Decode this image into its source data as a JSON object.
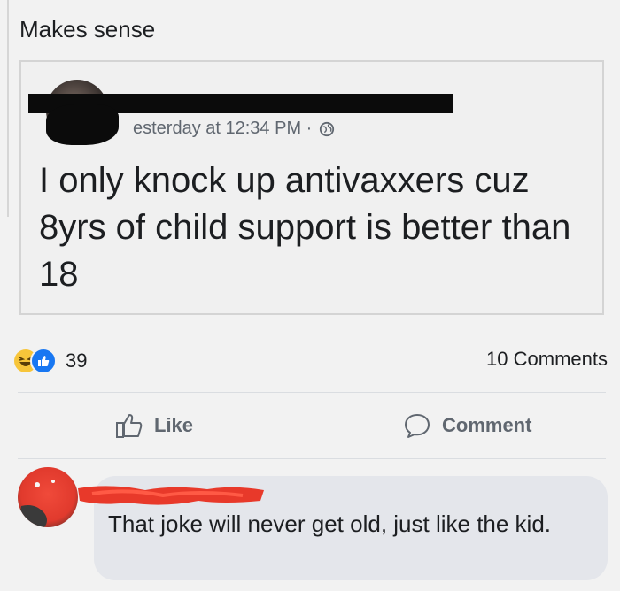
{
  "post": {
    "caption": "Makes sense"
  },
  "shared_post": {
    "timestamp": "esterday at 12:34 PM ·",
    "privacy_icon": "globe-icon",
    "text": "I only knock up antivaxxers cuz 8yrs of child support is better than 18"
  },
  "stats": {
    "reaction_icons": [
      "haha-icon",
      "like-icon"
    ],
    "reaction_count": "39",
    "comments_label": "10 Comments"
  },
  "actions": {
    "like_label": "Like",
    "comment_label": "Comment"
  },
  "comment": {
    "text": "That joke will never get old, just like the kid."
  },
  "colors": {
    "background": "#f2f2f2",
    "like_blue": "#1877f2",
    "haha_yellow": "#f7c53a",
    "bubble": "#e4e6eb",
    "muted_text": "#606770",
    "redaction_red": "#e8392a"
  }
}
